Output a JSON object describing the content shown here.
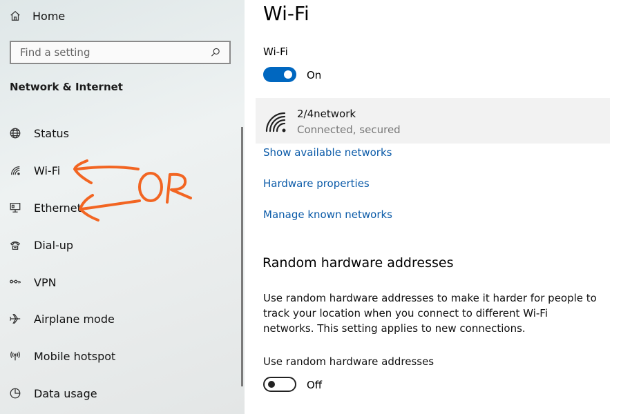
{
  "sidebar": {
    "home_label": "Home",
    "search_placeholder": "Find a setting",
    "section_title": "Network & Internet",
    "items": [
      {
        "label": "Status",
        "icon": "globe-icon"
      },
      {
        "label": "Wi-Fi",
        "icon": "wifi-icon"
      },
      {
        "label": "Ethernet",
        "icon": "ethernet-icon"
      },
      {
        "label": "Dial-up",
        "icon": "dialup-icon"
      },
      {
        "label": "VPN",
        "icon": "vpn-icon"
      },
      {
        "label": "Airplane mode",
        "icon": "airplane-icon"
      },
      {
        "label": "Mobile hotspot",
        "icon": "hotspot-icon"
      },
      {
        "label": "Data usage",
        "icon": "data-usage-icon"
      }
    ]
  },
  "main": {
    "title": "Wi-Fi",
    "wifi_label": "Wi-Fi",
    "wifi_toggle_state": "On",
    "network": {
      "name": "2/4network",
      "status": "Connected, secured"
    },
    "links": {
      "show_networks": "Show available networks",
      "hardware_properties": "Hardware properties",
      "manage_networks": "Manage known networks"
    },
    "random_section": {
      "heading": "Random hardware addresses",
      "description": "Use random hardware addresses to make it harder for people to track your location when you connect to different Wi-Fi networks. This setting applies to new connections.",
      "toggle_label": "Use random hardware addresses",
      "toggle_state": "Off"
    }
  },
  "annotation": {
    "text": "OR",
    "color": "#f26522"
  },
  "colors": {
    "accent": "#0067c0",
    "link": "#0a5aa8"
  }
}
